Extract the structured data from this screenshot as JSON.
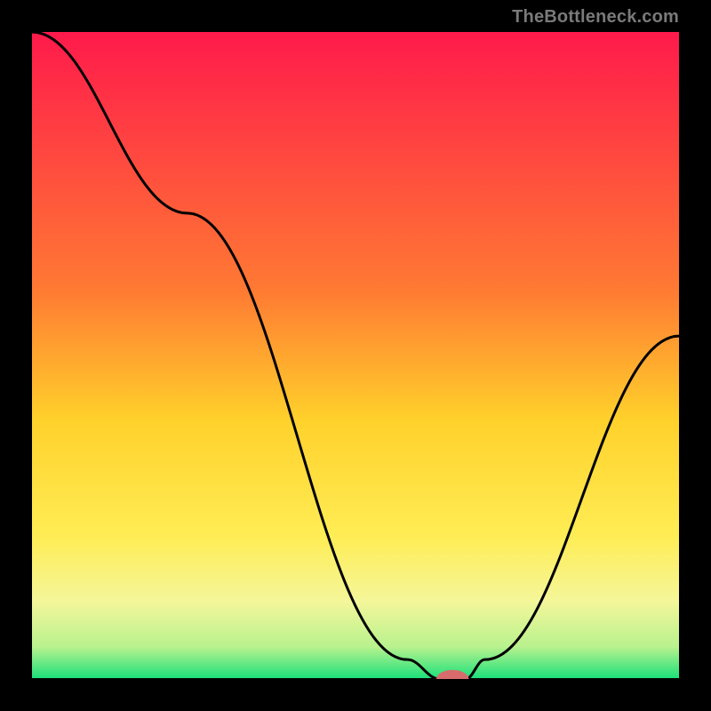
{
  "watermark": "TheBottleneck.com",
  "chart_data": {
    "type": "line",
    "title": "",
    "xlabel": "",
    "ylabel": "",
    "xlim": [
      0,
      100
    ],
    "ylim": [
      0,
      100
    ],
    "gradient_stops": [
      {
        "offset": 0,
        "color": "#ff1a4b"
      },
      {
        "offset": 0.4,
        "color": "#ff7a33"
      },
      {
        "offset": 0.6,
        "color": "#ffd12b"
      },
      {
        "offset": 0.78,
        "color": "#ffed55"
      },
      {
        "offset": 0.88,
        "color": "#f4f69a"
      },
      {
        "offset": 0.95,
        "color": "#b9f28e"
      },
      {
        "offset": 1.0,
        "color": "#19e07a"
      }
    ],
    "curve": {
      "x": [
        0,
        24,
        58,
        63,
        67,
        70,
        100
      ],
      "y": [
        100,
        72,
        3,
        0,
        0,
        3,
        53
      ]
    },
    "marker": {
      "x": 65,
      "y": 0,
      "color": "#d86b6b",
      "rx": 2.5,
      "ry": 1.0
    },
    "baseline": {
      "y": 0,
      "color": "#000000"
    }
  }
}
